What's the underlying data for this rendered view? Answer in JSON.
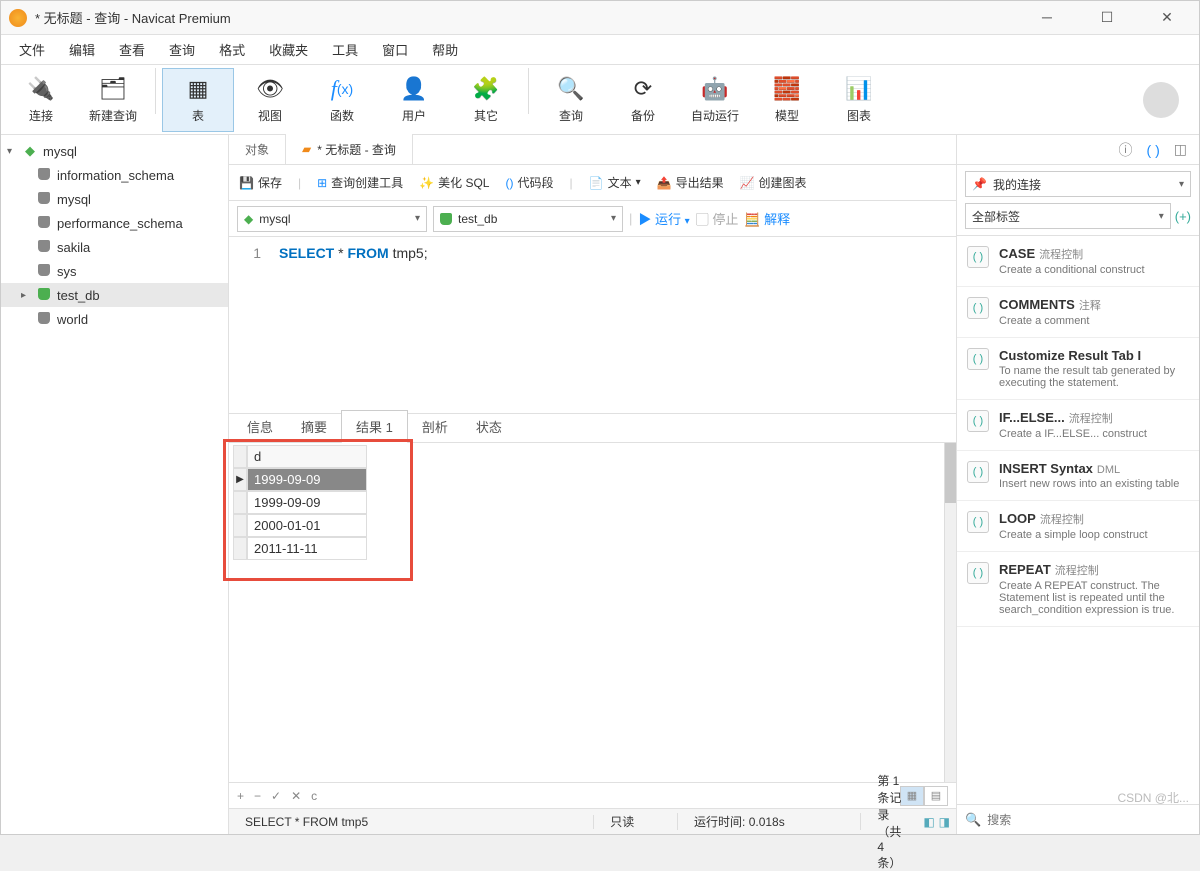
{
  "title": "* 无标题 - 查询 - Navicat Premium",
  "menu": [
    "文件",
    "编辑",
    "查看",
    "查询",
    "格式",
    "收藏夹",
    "工具",
    "窗口",
    "帮助"
  ],
  "toolbar": [
    {
      "label": "连接",
      "icon": "🔌",
      "dd": true
    },
    {
      "label": "新建查询",
      "icon": "🗂"
    },
    {
      "label": "表",
      "icon": "▦",
      "active": true
    },
    {
      "label": "视图",
      "icon": "👁"
    },
    {
      "label": "函数",
      "icon": "f(x)",
      "fx": true
    },
    {
      "label": "用户",
      "icon": "👤"
    },
    {
      "label": "其它",
      "icon": "🧩"
    },
    {
      "label": "查询",
      "icon": "🔍"
    },
    {
      "label": "备份",
      "icon": "⟳"
    },
    {
      "label": "自动运行",
      "icon": "🤖"
    },
    {
      "label": "模型",
      "icon": "🧱"
    },
    {
      "label": "图表",
      "icon": "📊"
    }
  ],
  "tree": {
    "root": "mysql",
    "children": [
      "information_schema",
      "mysql",
      "performance_schema",
      "sakila",
      "sys",
      "test_db",
      "world"
    ],
    "selected": "test_db"
  },
  "content_tabs": [
    {
      "label": "对象",
      "active": false
    },
    {
      "label": "* 无标题 - 查询",
      "active": true
    }
  ],
  "toolbar2": {
    "save": "保存",
    "builder": "查询创建工具",
    "beautify": "美化 SQL",
    "snippet": "代码段",
    "text": "文本",
    "export": "导出结果",
    "chart": "创建图表"
  },
  "selectors": {
    "connection": "mysql",
    "database": "test_db",
    "run": "运行",
    "stop": "停止",
    "explain": "解释"
  },
  "sql_line": "1",
  "sql": {
    "kw1": "SELECT",
    "star": "*",
    "kw2": "FROM",
    "tbl": "tmp5",
    "semi": ";"
  },
  "result_tabs": [
    "信息",
    "摘要",
    "结果 1",
    "剖析",
    "状态"
  ],
  "result_active": 2,
  "grid": {
    "header": "d",
    "rows": [
      "1999-09-09",
      "1999-09-09",
      "2000-01-01",
      "2011-11-11"
    ],
    "selected": 0
  },
  "result_foot": {
    "plus": "+",
    "minus": "−",
    "check": "✓",
    "x": "✕",
    "refresh": "c"
  },
  "status": {
    "sql": "SELECT * FROM tmp5",
    "mode": "只读",
    "time_label": "运行时间:",
    "time": "0.018s",
    "record": "第 1 条记录 （共 4 条）"
  },
  "watermark": "CSDN @北...",
  "rightpanel": {
    "combo1": "我的连接",
    "combo2": "全部标签",
    "search_placeholder": "搜索",
    "snippets": [
      {
        "title": "CASE",
        "tag": "流程控制",
        "desc": "Create a conditional construct"
      },
      {
        "title": "COMMENTS",
        "tag": "注释",
        "desc": "Create a comment"
      },
      {
        "title": "Customize Result Tab I",
        "tag": "",
        "desc": "To name the result tab generated by executing the statement."
      },
      {
        "title": "IF...ELSE...",
        "tag": "流程控制",
        "desc": "Create a IF...ELSE... construct"
      },
      {
        "title": "INSERT Syntax",
        "tag": "DML",
        "desc": "Insert new rows into an existing table"
      },
      {
        "title": "LOOP",
        "tag": "流程控制",
        "desc": "Create a simple loop construct"
      },
      {
        "title": "REPEAT",
        "tag": "流程控制",
        "desc": "Create A REPEAT construct. The Statement list is repeated until the search_condition expression is true."
      }
    ]
  }
}
